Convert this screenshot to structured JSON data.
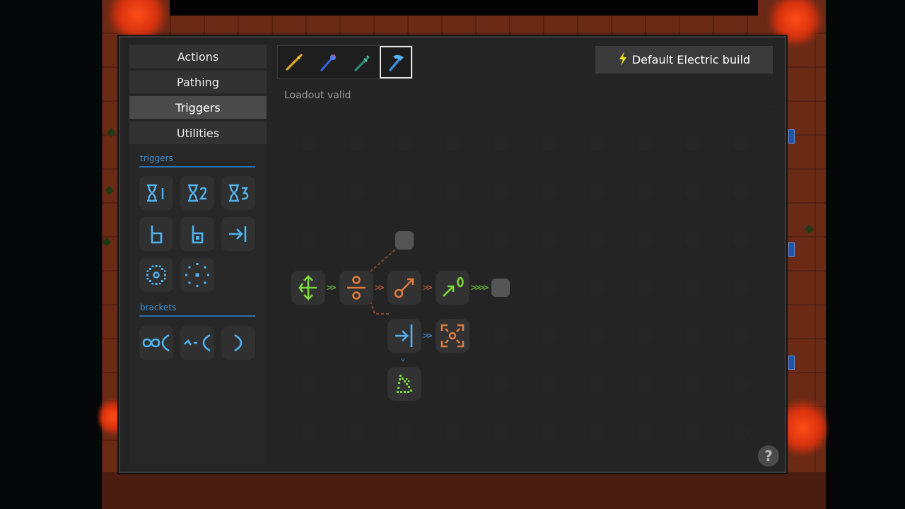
{
  "sidebar": {
    "tabs": [
      {
        "label": "Actions",
        "active": false
      },
      {
        "label": "Pathing",
        "active": false
      },
      {
        "label": "Triggers",
        "active": true
      },
      {
        "label": "Utilities",
        "active": false
      }
    ],
    "sections": {
      "triggers": "triggers",
      "brackets": "brackets"
    },
    "trigger_icons": [
      "timer-1-icon",
      "timer-2-icon",
      "timer-3-icon",
      "collision-trigger-icon",
      "collision-trigger-alt-icon",
      "arrow-to-bar-icon",
      "dense-ring-icon",
      "sparse-ring-icon"
    ],
    "bracket_icons": [
      "infinity-bracket-icon",
      "wave-bracket-icon",
      "close-bracket-icon"
    ]
  },
  "wands": {
    "items": [
      "yellow-wand-icon",
      "blue-wand-icon",
      "green-wand-icon",
      "hammer-wand-icon"
    ],
    "selected_index": 3
  },
  "build_button": {
    "label": "Default Electric build",
    "icon": "lightning-icon",
    "icon_color": "#f4e81e"
  },
  "status": {
    "text": "Loadout valid"
  },
  "grid": {
    "placed_nodes": [
      "split-arrows-icon",
      "divide-icon",
      "bolt-shot-icon",
      "green-arrow-icon",
      "arrow-to-bar-icon",
      "burst-icon",
      "triangle-dots-icon"
    ]
  },
  "help": {
    "label": "?"
  },
  "colors": {
    "accent_blue": "#4fb3f0",
    "accent_orange": "#e07a3c",
    "accent_green": "#7ad83a",
    "panel_bg": "#242424"
  }
}
